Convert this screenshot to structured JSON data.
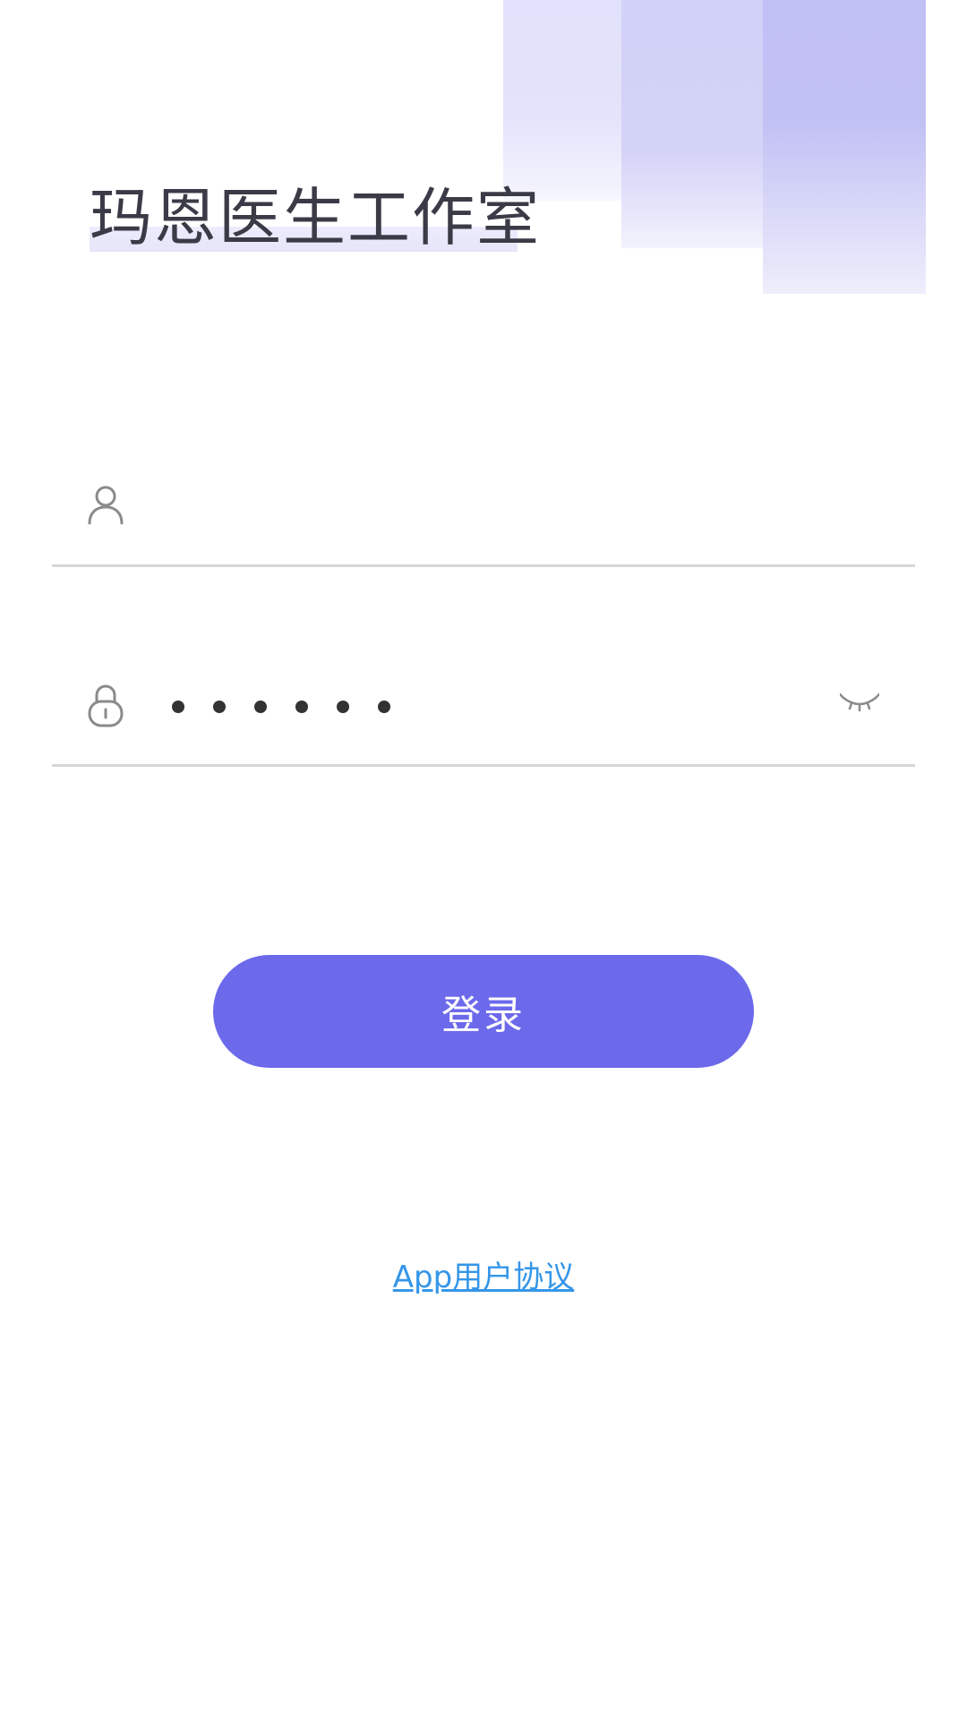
{
  "header": {
    "title": "玛恩医生工作室"
  },
  "form": {
    "username": {
      "icon": "user-icon",
      "value": "",
      "placeholder": ""
    },
    "password": {
      "icon": "lock-icon",
      "masked_length": 6,
      "toggle_icon": "eye-closed-icon"
    },
    "login_label": "登录"
  },
  "footer": {
    "agreement_link": "App用户协议"
  },
  "colors": {
    "accent": "#6c69eb",
    "link": "#3596e8",
    "title_text": "#3b3b47",
    "divider": "#d6d6d6"
  }
}
